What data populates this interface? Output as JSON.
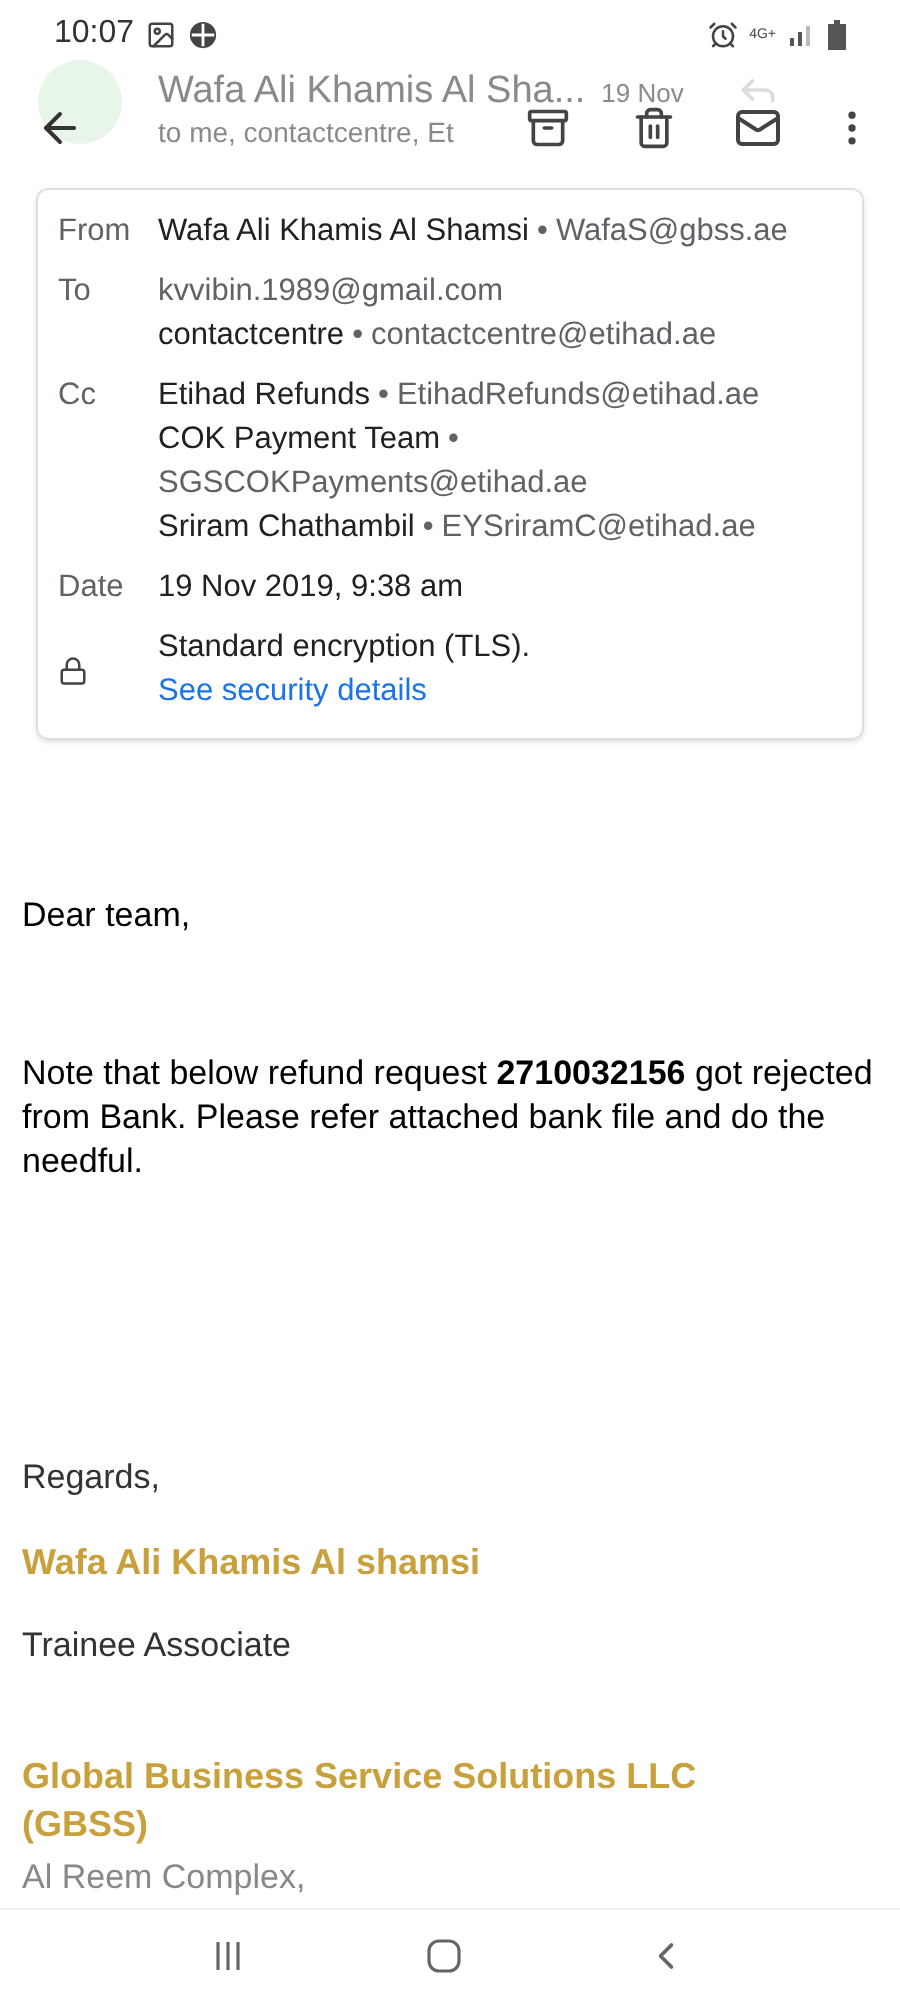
{
  "status_bar": {
    "time": "10:07",
    "network": "4G+"
  },
  "header": {
    "sender": "Wafa Ali Khamis Al Sha...",
    "date": "19 Nov",
    "recipients": "to me, contactcentre, Et"
  },
  "details": {
    "rows": [
      {
        "label": "From",
        "lines": [
          {
            "name": "Wafa Ali Khamis Al Shamsi",
            "email": "WafaS@gbss.ae"
          }
        ]
      },
      {
        "label": "To",
        "lines": [
          {
            "email": "kvvibin.1989@gmail.com"
          },
          {
            "name": "contactcentre",
            "email": "contactcentre@etihad.ae"
          }
        ]
      },
      {
        "label": "Cc",
        "lines": [
          {
            "name": "Etihad Refunds",
            "email": "EtihadRefunds@etihad.ae"
          },
          {
            "name": "COK Payment Team",
            "email": "SGSCOKPayments@etihad.ae"
          },
          {
            "name": "Sriram Chathambil",
            "email": "EYSriramC@etihad.ae"
          }
        ]
      },
      {
        "label": "Date",
        "lines": [
          {
            "name": "19 Nov 2019, 9:38 am"
          }
        ]
      }
    ],
    "separator": "•",
    "security": {
      "text": "Standard encryption (TLS).",
      "link": "See security details"
    }
  },
  "body": {
    "greeting": "Dear team,",
    "message": "Note that below refund request **2710032156** got rejected from Bank. Please refer attached bank file and do the needful.",
    "closing": "Regards,",
    "signature_name": "Wafa Ali Khamis Al shamsi",
    "signature_title": "Trainee Associate",
    "company": "Global Business Service Solutions LLC (GBSS)",
    "address": "Al Reem Complex,"
  }
}
